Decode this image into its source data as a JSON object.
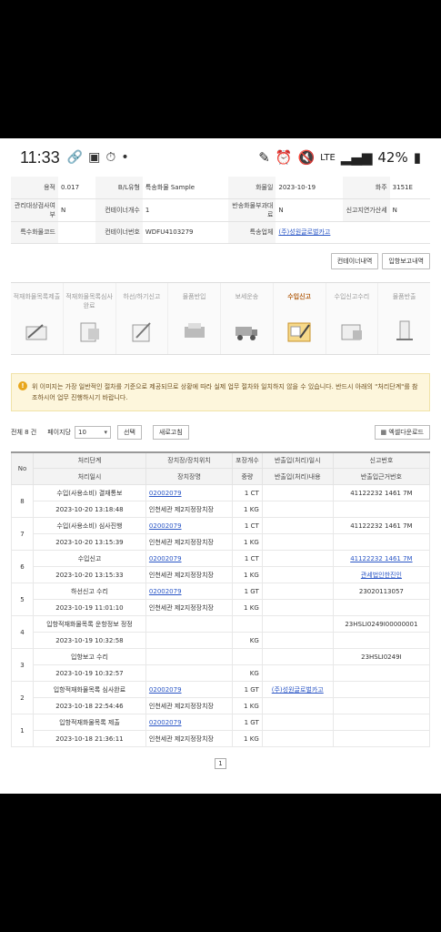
{
  "status": {
    "time": "11:33",
    "battery": "42%",
    "network": "LTE"
  },
  "info": {
    "r1": [
      {
        "l": "용적",
        "v": "0.017"
      },
      {
        "l": "B/L유형",
        "v": "특송화물 Sample"
      },
      {
        "l": "화물일",
        "v": "2023-10-19"
      },
      {
        "l": "화주",
        "v": "3151E"
      }
    ],
    "r2": [
      {
        "l": "관리대상검사여부",
        "v": "N"
      },
      {
        "l": "컨테이너개수",
        "v": "1"
      },
      {
        "l": "반송화물부과대료",
        "v": "N"
      },
      {
        "l": "신고지연가산세",
        "v": "N"
      }
    ],
    "r3": [
      {
        "l": "특수화물코드",
        "v": ""
      },
      {
        "l": "컨테이너번호",
        "v": "WDFU4103279"
      },
      {
        "l": "특송업체",
        "v": "(주)성원글로벌카고"
      }
    ]
  },
  "buttons": {
    "container": "컨테이너내역",
    "entry": "입항보고내역"
  },
  "steps": [
    {
      "label": "적재화물목록제출",
      "active": false
    },
    {
      "label": "적재화물목록심사완료",
      "active": false
    },
    {
      "label": "하선/하기신고",
      "active": false
    },
    {
      "label": "물품반입",
      "active": false
    },
    {
      "label": "보세운송",
      "active": false
    },
    {
      "label": "수입신고",
      "active": true
    },
    {
      "label": "수입신고수리",
      "active": false
    },
    {
      "label": "물품반출",
      "active": false
    }
  ],
  "notice": {
    "icon": "!",
    "text": "위 이미지는 가장 일반적인 절차를 기준으로 제공되므로 상황에 따라 실제 업무 절차와 일치하지 않을 수 있습니다. 반드시 아래의 \"처리단계\"를 참조하시어 업무 진행하시기 바랍니다."
  },
  "toolbar": {
    "total": "전체 8 건",
    "per_page_label": "페이지당",
    "per_page_value": "10",
    "select_btn": "선택",
    "refresh": "새로고침",
    "excel": "엑셀다운로드"
  },
  "grid": {
    "headers": {
      "no": "No",
      "h1a": "처리단계",
      "h1b": "처리일시",
      "h2a": "장치장/장치위치",
      "h2b": "장치장명",
      "h3a": "포장개수",
      "h3b": "중량",
      "h4a": "반출입(처리)일시",
      "h4b": "반출입(처리)내용",
      "h5a": "신고번호",
      "h5b": "반출입근거번호"
    },
    "rows": [
      {
        "no": "8",
        "step": "수입(사용소비) 결재통보",
        "dt": "2023-10-20 13:18:48",
        "code": "02002079",
        "loc": "인천세관 제2지정장치장",
        "pkg": "1 CT",
        "wt": "1 KG",
        "io_dt": "",
        "io_c": "",
        "decl": "41122232 1461 7M",
        "decl_link": false,
        "basis": ""
      },
      {
        "no": "7",
        "step": "수입(사용소비) 심사진행",
        "dt": "2023-10-20 13:15:39",
        "code": "02002079",
        "loc": "인천세관 제2지정장치장",
        "pkg": "1 CT",
        "wt": "1 KG",
        "io_dt": "",
        "io_c": "",
        "decl": "41122232 1461 7M",
        "decl_link": false,
        "basis": ""
      },
      {
        "no": "6",
        "step": "수입신고",
        "dt": "2023-10-20 13:15:33",
        "code": "02002079",
        "loc": "인천세관 제2지정장치장",
        "pkg": "1 CT",
        "wt": "1 KG",
        "io_dt": "",
        "io_c": "",
        "decl": "41122232 1461 7M",
        "decl_link": true,
        "basis": "관세법인한진인",
        "basis_link": true
      },
      {
        "no": "5",
        "step": "하선신고 수리",
        "dt": "2023-10-19 11:01:10",
        "code": "02002079",
        "loc": "인천세관 제2지정장치장",
        "pkg": "1 GT",
        "wt": "1 KG",
        "io_dt": "",
        "io_c": "",
        "decl": "23020113057",
        "decl_link": false,
        "basis": ""
      },
      {
        "no": "4",
        "step": "입항적재화물목록 운항정보 정정",
        "dt": "2023-10-19 10:32:58",
        "code": "",
        "loc": "",
        "pkg": "",
        "wt": "KG",
        "io_dt": "",
        "io_c": "",
        "decl": "23HSLI0249I00000001",
        "decl_link": false,
        "basis": ""
      },
      {
        "no": "3",
        "step": "입항보고 수리",
        "dt": "2023-10-19 10:32:57",
        "code": "",
        "loc": "",
        "pkg": "",
        "wt": "KG",
        "io_dt": "",
        "io_c": "",
        "decl": "23HSLI0249I",
        "decl_link": false,
        "basis": ""
      },
      {
        "no": "2",
        "step": "입항적재화물목록 심사완료",
        "dt": "2023-10-18 22:54:46",
        "code": "02002079",
        "loc": "인천세관 제2지정장치장",
        "pkg": "1 GT",
        "wt": "1 KG",
        "io_dt": "(주)성원글로벌카고",
        "io_c": "",
        "decl": "",
        "decl_link": false,
        "basis": ""
      },
      {
        "no": "1",
        "step": "입항적재화물목록 제출",
        "dt": "2023-10-18 21:36:11",
        "code": "02002079",
        "loc": "인천세관 제2지정장치장",
        "pkg": "1 GT",
        "wt": "1 KG",
        "io_dt": "",
        "io_c": "",
        "decl": "",
        "decl_link": false,
        "basis": ""
      }
    ]
  },
  "pager": {
    "current": "1"
  }
}
